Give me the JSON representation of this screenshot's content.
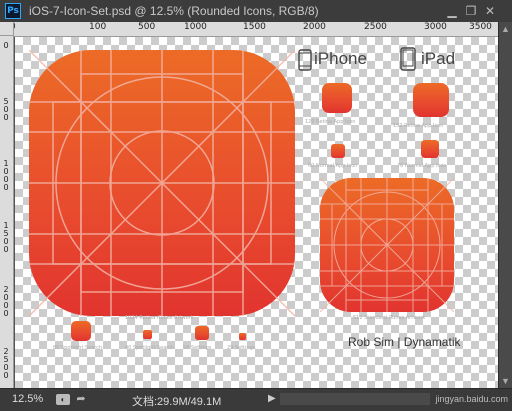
{
  "window": {
    "app_logo": "Ps",
    "title": "iOS-7-Icon-Set.psd @ 12.5% (Rounded Icons, RGB/8)",
    "minimize": "▁",
    "restore": "❐",
    "close": "✕"
  },
  "rulers": {
    "horizontal": [
      "0",
      "100",
      "500",
      "1000",
      "1500",
      "2000",
      "2500",
      "3000",
      "3500"
    ],
    "vertical": [
      "0",
      "500",
      "1000",
      "1500",
      "2000",
      "2500"
    ]
  },
  "canvas": {
    "device_labels": {
      "iphone": "iPhone",
      "ipad": "iPad"
    },
    "credit": "Rob Sim | Dynamatik",
    "captions": {
      "large_left": "1024 Retina iTunes Artwork",
      "large_right": "512 Standard iTunes Artwork",
      "iphone_app": "120 Retina App Icon",
      "ipad_app": "152 Retina App Icon",
      "iphone_normal": "60 Normal App Icon",
      "ipad_normal": "76 Normal App Icon",
      "spot1": "80 Spotlight Search",
      "spot2": "40 Spotlight Search",
      "settings1": "58 Settings",
      "settings2": "29 Settings"
    },
    "icon_gradient": [
      "#ec6a26",
      "#e0342f"
    ]
  },
  "status": {
    "zoom": "12.5%",
    "doc_info": "文档:29.9M/49.1M",
    "more_arrow": "▶"
  },
  "watermark": "jingyan.baidu.com"
}
